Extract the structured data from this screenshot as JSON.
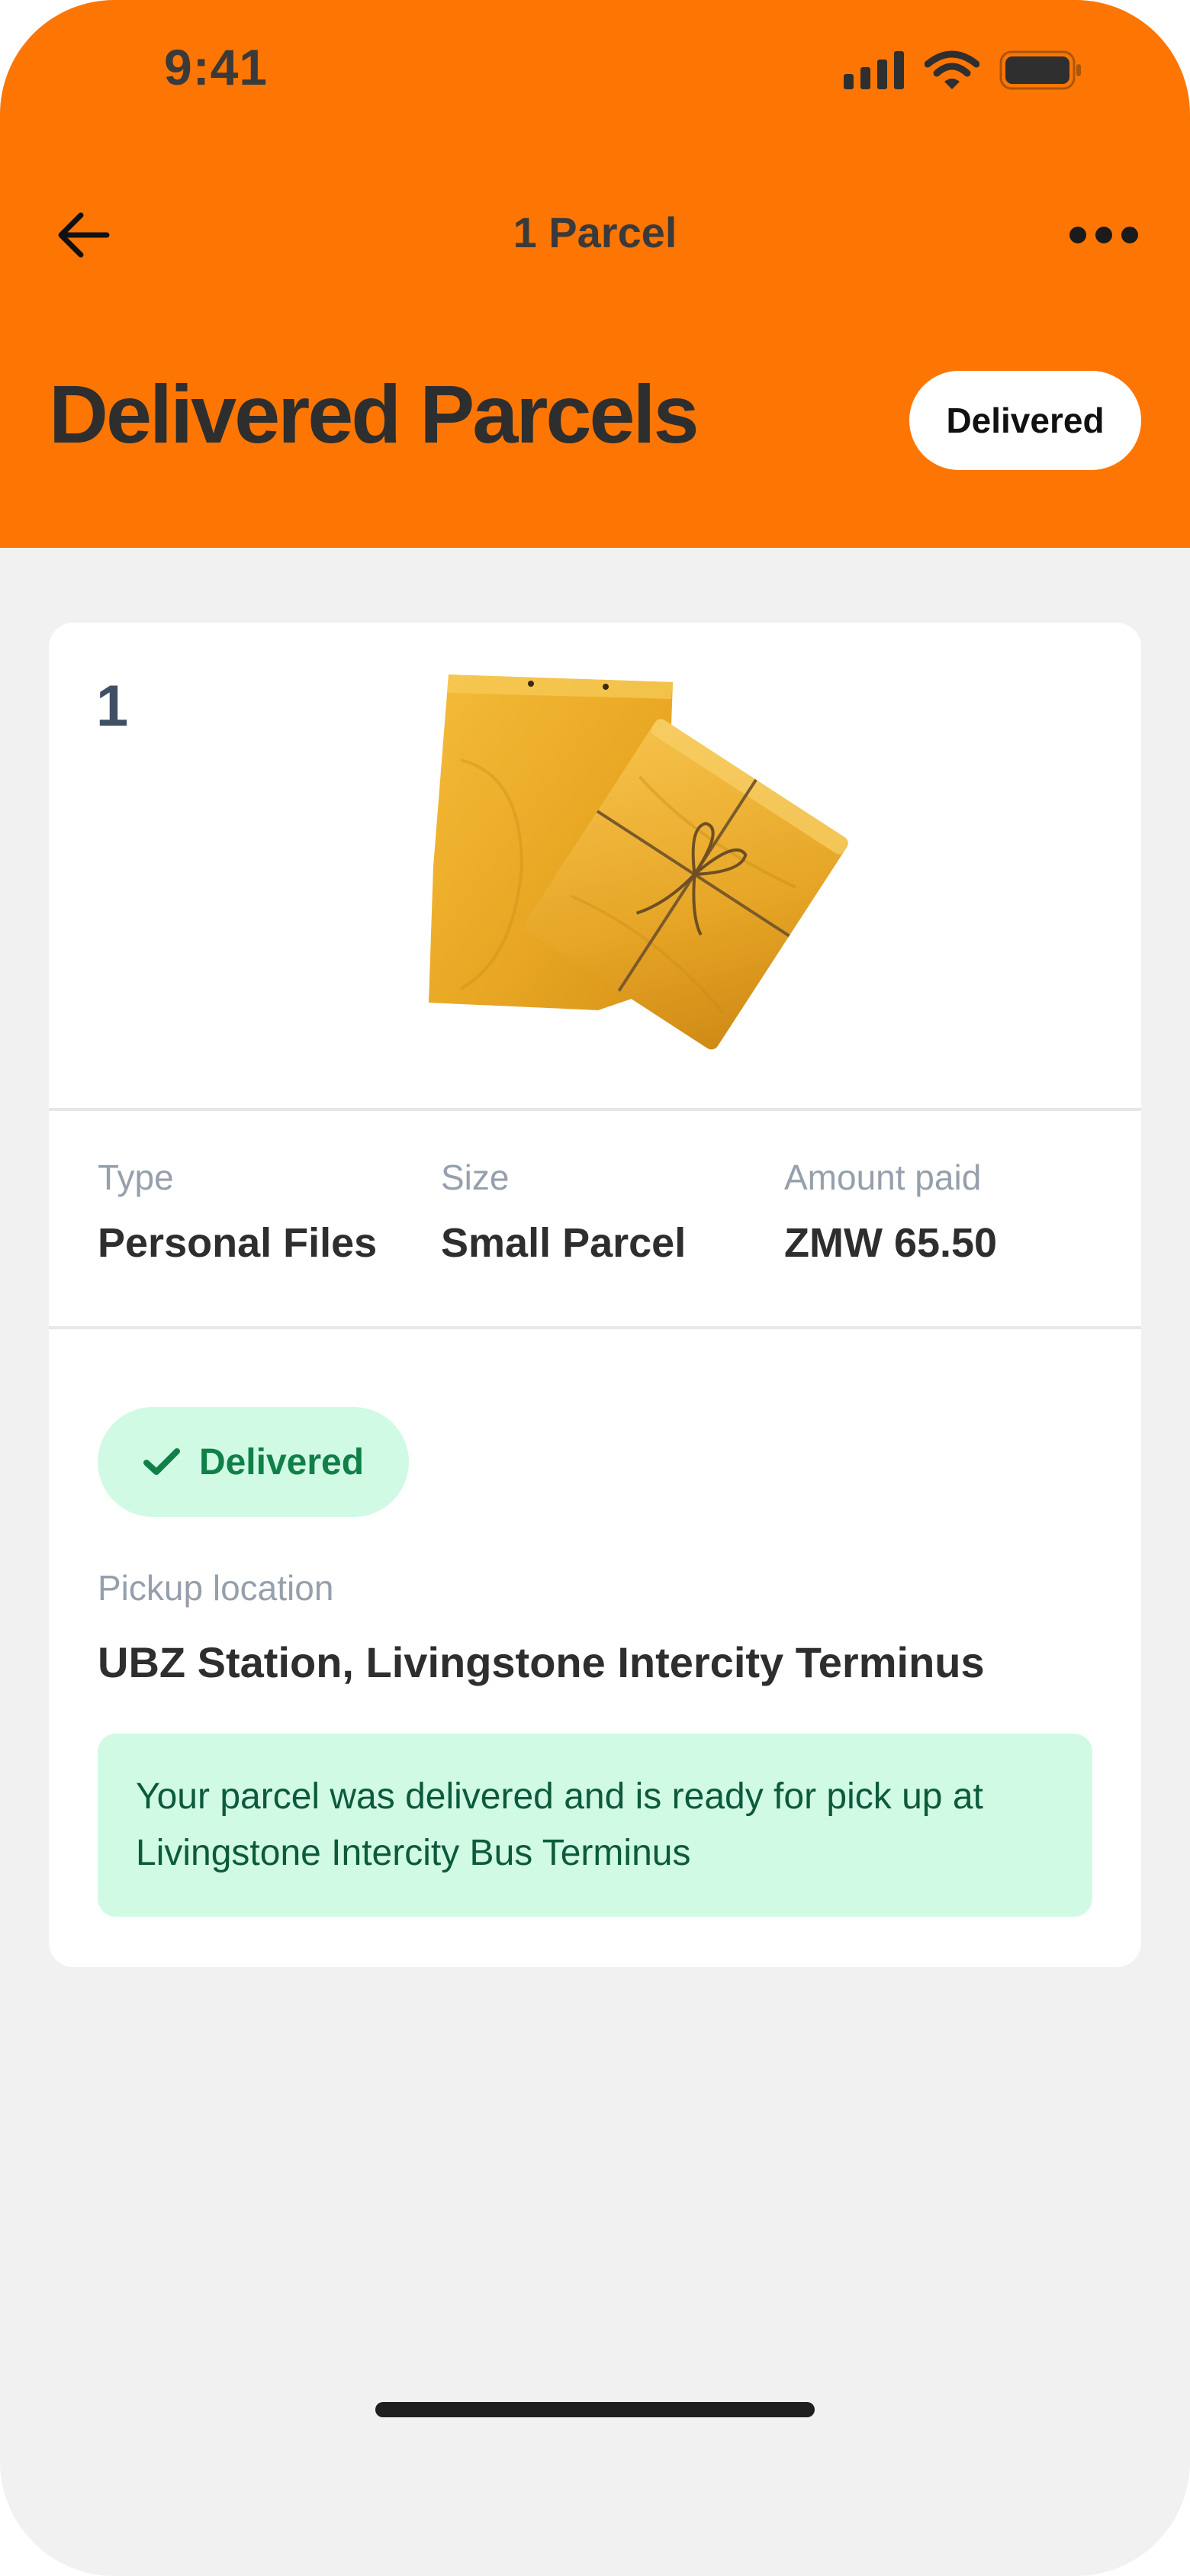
{
  "status_bar": {
    "time": "9:41",
    "icons": [
      "signal-icon",
      "wifi-icon",
      "battery-icon"
    ]
  },
  "nav": {
    "back_icon": "arrow-left-icon",
    "title": "1 Parcel",
    "more_icon": "more-horizontal-icon"
  },
  "header": {
    "title": "Delivered Parcels",
    "status_filter": "Delivered",
    "background_color": "#fd7604"
  },
  "parcel": {
    "index": "1",
    "image": "parcel-envelopes-image",
    "details": [
      {
        "label": "Type",
        "value": "Personal Files"
      },
      {
        "label": "Size",
        "value": "Small Parcel"
      },
      {
        "label": "Amount paid",
        "value": "ZMW 65.50"
      }
    ],
    "status": {
      "icon": "check-icon",
      "label": "Delivered",
      "color": "#108048"
    },
    "pickup": {
      "label": "Pickup location",
      "value": "UBZ Station, Livingstone Intercity Terminus"
    },
    "notice": "Your parcel was delivered and is ready for pick up at Livingstone Intercity Bus Terminus"
  }
}
